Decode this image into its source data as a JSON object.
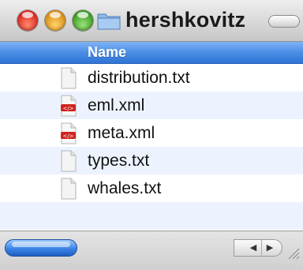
{
  "window": {
    "title": "hershkovitz"
  },
  "columns": {
    "name_label": "Name"
  },
  "files": [
    {
      "name": "distribution.txt",
      "icon": "text-file-icon"
    },
    {
      "name": "eml.xml",
      "icon": "xml-file-icon"
    },
    {
      "name": "meta.xml",
      "icon": "xml-file-icon"
    },
    {
      "name": "types.txt",
      "icon": "text-file-icon"
    },
    {
      "name": "whales.txt",
      "icon": "text-file-icon"
    }
  ],
  "colors": {
    "header_blue": "#4b8de6",
    "alt_row": "#edf3fe",
    "xml_badge": "#d0231b"
  },
  "scroll_arrows": {
    "left": "◀",
    "right": "▶"
  }
}
